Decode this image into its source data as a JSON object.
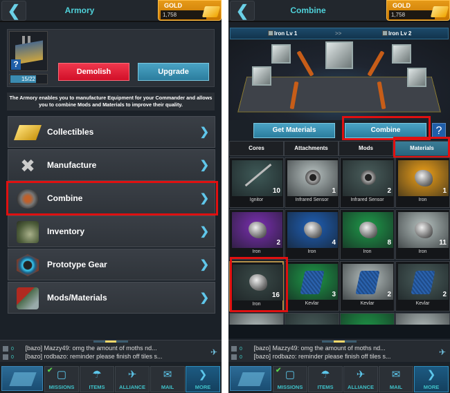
{
  "left": {
    "header": {
      "title": "Armory",
      "back_icon": "back-chevron-icon"
    },
    "gold": {
      "label": "GOLD",
      "value": "1,758",
      "icon": "gold-bars-icon"
    },
    "building": {
      "level_text": "15/22",
      "level_progress": 0.68,
      "help_label": "?"
    },
    "buttons": {
      "demolish": "Demolish",
      "upgrade": "Upgrade"
    },
    "description": "The Armory enables you to manufacture Equipment for your Commander and allows you to combine Mods and Materials to improve their quality.",
    "menu": [
      {
        "label": "Collectibles",
        "icon": "gold-tickets-icon"
      },
      {
        "label": "Manufacture",
        "icon": "tools-icon"
      },
      {
        "label": "Combine",
        "icon": "combine-machine-icon",
        "highlighted": true
      },
      {
        "label": "Inventory",
        "icon": "gear-pack-icon"
      },
      {
        "label": "Prototype Gear",
        "icon": "prototype-hex-icon"
      },
      {
        "label": "Mods/Materials",
        "icon": "mods-materials-icon"
      }
    ]
  },
  "right": {
    "header": {
      "title": "Combine"
    },
    "gold": {
      "label": "GOLD",
      "value": "1,758"
    },
    "combine_bar": {
      "from": "Iron Lv 1",
      "arrow": ">>",
      "to": "Iron Lv 2"
    },
    "buttons": {
      "get_materials": "Get Materials",
      "combine": "Combine",
      "help": "?"
    },
    "tabs": [
      {
        "label": "Cores"
      },
      {
        "label": "Attachments"
      },
      {
        "label": "Mods"
      },
      {
        "label": "Materials",
        "active": true
      }
    ],
    "items": [
      {
        "name": "Ignitor",
        "count": "10",
        "bg": "#3f5a58",
        "kind": "pin"
      },
      {
        "name": "Infrared Sensor",
        "count": "1",
        "bg": "#b9c3c2",
        "kind": "sensor"
      },
      {
        "name": "Infrared Sensor",
        "count": "2",
        "bg": "#4a5e5c",
        "kind": "sensor"
      },
      {
        "name": "Iron",
        "count": "1",
        "bg": "#f0a21a",
        "kind": "rock"
      },
      {
        "name": "Iron",
        "count": "2",
        "bg": "#7a2fb0",
        "kind": "rock"
      },
      {
        "name": "Iron",
        "count": "4",
        "bg": "#1f5fb5",
        "kind": "rock"
      },
      {
        "name": "Iron",
        "count": "8",
        "bg": "#1f9a4a",
        "kind": "rock"
      },
      {
        "name": "Iron",
        "count": "11",
        "bg": "#b7c2c0",
        "kind": "rock"
      },
      {
        "name": "Iron",
        "count": "16",
        "bg": "#3a4a48",
        "kind": "rock",
        "selected": true
      },
      {
        "name": "Kevlar",
        "count": "3",
        "bg": "#1e9a48",
        "kind": "kevlar"
      },
      {
        "name": "Kevlar",
        "count": "2",
        "bg": "#b9c3c2",
        "kind": "kevlar"
      },
      {
        "name": "Kevlar",
        "count": "2",
        "bg": "#4a5e5c",
        "kind": "kevlar"
      }
    ]
  },
  "chat": {
    "friends_count": "0",
    "messages_count": "0",
    "lines": [
      "[bazo] Mazzy49: omg the amount of  moths nd...",
      "[bazo] rodbazo: reminder please finish off tiles s..."
    ]
  },
  "nav": [
    {
      "label": "MISSIONS",
      "icon": "missions-target-icon",
      "completed": true
    },
    {
      "label": "ITEMS",
      "icon": "parachute-crate-icon"
    },
    {
      "label": "ALLIANCE",
      "icon": "eagle-emblem-icon"
    },
    {
      "label": "MAIL",
      "icon": "envelope-icon"
    },
    {
      "label": "MORE",
      "icon": "chevron-right-icon"
    }
  ],
  "colors": {
    "accent_teal": "#4fd1d9",
    "highlight_red": "#e01010",
    "demolish_red": "#e01f36",
    "upgrade_blue": "#3a90b1",
    "gold_orange": "#e69a18"
  }
}
